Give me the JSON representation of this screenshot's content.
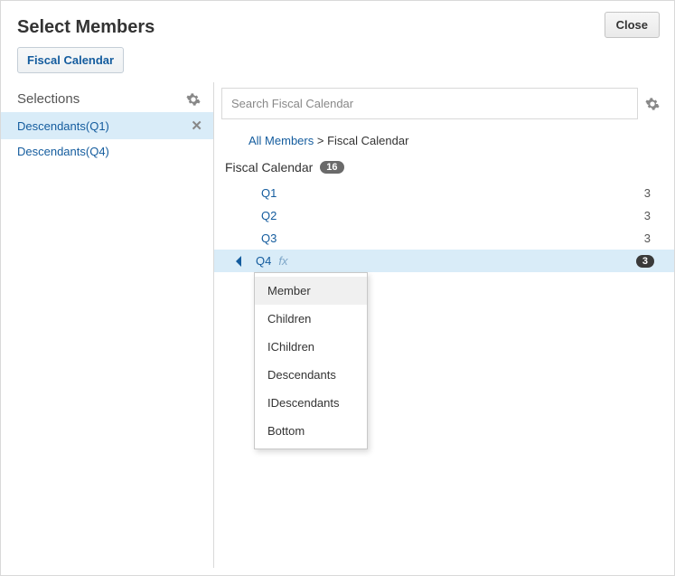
{
  "header": {
    "title": "Select Members",
    "close": "Close"
  },
  "dimension_button": "Fiscal Calendar",
  "sidebar": {
    "title": "Selections",
    "items": [
      {
        "label": "Descendants(Q1)",
        "active": true
      },
      {
        "label": "Descendants(Q4)",
        "active": false
      }
    ]
  },
  "main": {
    "search_placeholder": "Search Fiscal Calendar",
    "breadcrumb": [
      {
        "label": "All Members",
        "link": true
      },
      {
        "label": "Fiscal Calendar",
        "link": false
      }
    ],
    "breadcrumb_sep": ">",
    "tree_header": {
      "label": "Fiscal Calendar",
      "count": "16"
    },
    "rows": [
      {
        "label": "Q1",
        "count": "3",
        "selected": false
      },
      {
        "label": "Q2",
        "count": "3",
        "selected": false
      },
      {
        "label": "Q3",
        "count": "3",
        "selected": false
      },
      {
        "label": "Q4",
        "count": "3",
        "selected": true
      }
    ],
    "fx_label": "fx"
  },
  "menu": {
    "items": [
      "Member",
      "Children",
      "IChildren",
      "Descendants",
      "IDescendants",
      "Bottom"
    ],
    "hover_index": 0
  }
}
